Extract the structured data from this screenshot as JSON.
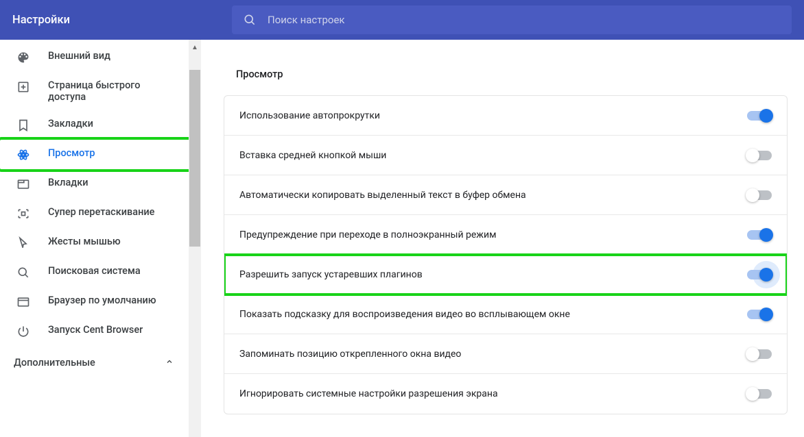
{
  "header": {
    "title": "Настройки",
    "search_placeholder": "Поиск настроек"
  },
  "sidebar": {
    "items": [
      {
        "id": "appearance",
        "label": "Внешний вид"
      },
      {
        "id": "speed-dial",
        "label": "Страница быстрого доступа"
      },
      {
        "id": "bookmarks",
        "label": "Закладки"
      },
      {
        "id": "browsing",
        "label": "Просмотр"
      },
      {
        "id": "tabs",
        "label": "Вкладки"
      },
      {
        "id": "super-drag",
        "label": "Супер перетаскивание"
      },
      {
        "id": "mouse-gestures",
        "label": "Жесты мышью"
      },
      {
        "id": "search-engine",
        "label": "Поисковая система"
      },
      {
        "id": "default-browser",
        "label": "Браузер по умолчанию"
      },
      {
        "id": "startup",
        "label": "Запуск Cent Browser"
      }
    ],
    "advanced_label": "Дополнительные"
  },
  "content": {
    "section_title": "Просмотр",
    "rows": [
      {
        "id": "autoscroll",
        "label": "Использование автопрокрутки",
        "on": true
      },
      {
        "id": "middle-click-paste",
        "label": "Вставка средней кнопкой мыши",
        "on": false
      },
      {
        "id": "auto-copy",
        "label": "Автоматически копировать выделенный текст в буфер обмена",
        "on": false
      },
      {
        "id": "fullscreen-warning",
        "label": "Предупреждение при переходе в полноэкранный режим",
        "on": true
      },
      {
        "id": "legacy-plugins",
        "label": "Разрешить запуск устаревших плагинов",
        "on": true,
        "highlight": true,
        "glow": true
      },
      {
        "id": "pip-hint",
        "label": "Показать подсказку для воспроизведения видео во всплывающем окне",
        "on": true
      },
      {
        "id": "remember-pip-pos",
        "label": "Запоминать позицию открепленного окна видео",
        "on": false
      },
      {
        "id": "ignore-dpi",
        "label": "Игнорировать системные настройки разрешения экрана",
        "on": false
      }
    ]
  }
}
